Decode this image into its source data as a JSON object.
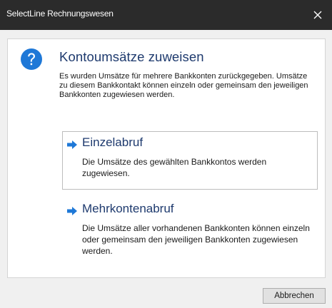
{
  "window": {
    "title": "SelectLine Rechnungswesen",
    "close_icon": "close-icon"
  },
  "dialog": {
    "icon": "question-icon",
    "heading": "Kontoumsätze zuweisen",
    "description": "Es wurden Umsätze für mehrere Bankkonten zurückgegeben. Umsätze zu diesem Bankkontakt können einzeln oder gemeinsam den jeweiligen Bankkonten zugewiesen werden.",
    "options": [
      {
        "icon": "arrow-right-icon",
        "title": "Einzelabruf",
        "description": "Die Umsätze des gewählten Bankkontos werden zugewiesen."
      },
      {
        "icon": "arrow-right-icon",
        "title": "Mehrkontenabruf",
        "description": "Die Umsätze aller vorhandenen Bankkonten können einzeln oder gemeinsam den jeweiligen Bankkonten zugewiesen werden."
      }
    ]
  },
  "footer": {
    "cancel_label": "Abbrechen"
  },
  "colors": {
    "titlebar": "#2b2b2b",
    "accent_blue": "#1e78d7",
    "heading_text": "#1e3a6e"
  }
}
